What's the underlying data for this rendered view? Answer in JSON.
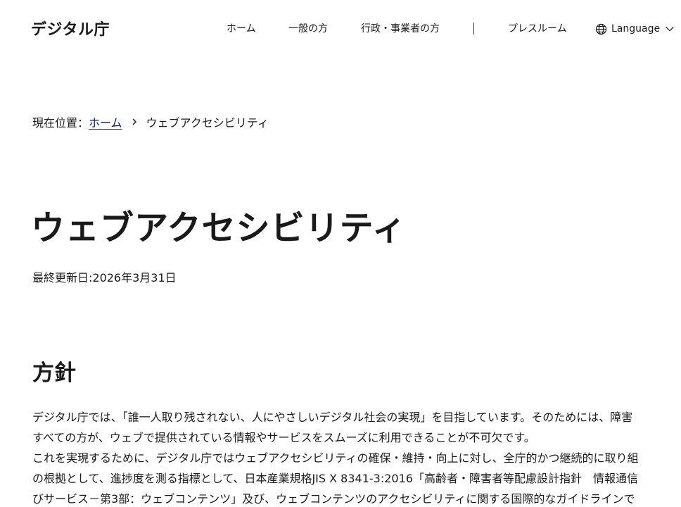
{
  "header": {
    "logo": "デジタル庁",
    "nav": {
      "home": "ホーム",
      "general": "一般の方",
      "business": "行政・事業者の方",
      "press": "プレスルーム",
      "language": "Language"
    }
  },
  "breadcrumb": {
    "prefix": "現在位置：",
    "home": "ホーム",
    "separator": "›",
    "current": "ウェブアクセシビリティ"
  },
  "main": {
    "title": "ウェブアクセシビリティ",
    "updated": "最終更新日:2026年3月31日",
    "section": {
      "title": "方針",
      "lines": [
        "デジタル庁では、「誰一人取り残されない、人にやさしいデジタル社会の実現」を目指しています。そのためには、障害",
        "すべての方が、ウェブで提供されている情報やサービスをスムーズに利用できることが不可欠です。",
        "これを実現するために、デジタル庁ではウェブアクセシビリティの確保・維持・向上に対し、全庁的かつ継続的に取り組",
        "の根拠として、進捗度を測る指標として、日本産業規格JIS X 8341-3:2016「高齢者・障害者等配慮設計指針　情報通信",
        "びサービス－第3部：ウェブコンテンツ」及び、ウェブコンテンツのアクセシビリティに関する国際的なガイドラインで"
      ]
    }
  },
  "icons": {
    "language": "globe-icon",
    "language_toggle": "chevron-down-icon",
    "breadcrumb_separator": "chevron-right-icon"
  },
  "colors": {
    "text": "#1a1a1a",
    "link": "#0a1a6e",
    "background": "#ffffff"
  }
}
